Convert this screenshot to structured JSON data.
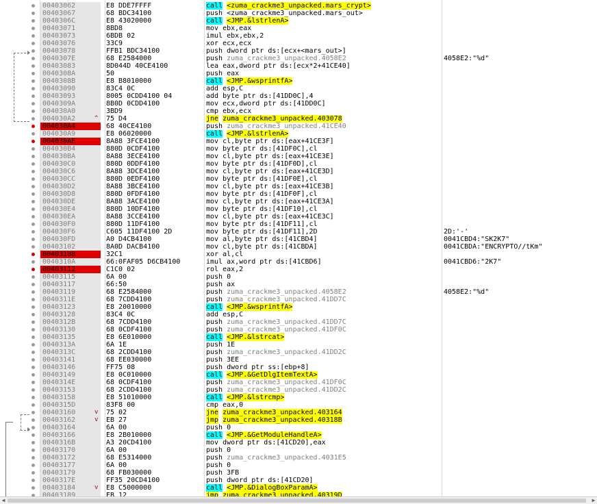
{
  "rows": [
    {
      "addr": "00403062",
      "bytes": "E8 DDE7FFFF",
      "kind": "call",
      "op": "call",
      "arg": "<zuma_crackme3_unpacked.mars_crypt>",
      "comment": ""
    },
    {
      "addr": "00403067",
      "bytes": "68 BDC34100",
      "kind": "plain",
      "op": "push",
      "arg": "<zuma_crackme3_unpacked.mars_out>",
      "comment": ""
    },
    {
      "addr": "0040306C",
      "bytes": "E8 43020000",
      "kind": "call",
      "op": "call",
      "arg": "<JMP.&lstrlenA>",
      "comment": ""
    },
    {
      "addr": "00403071",
      "bytes": "8BD8",
      "kind": "plain",
      "op": "mov",
      "arg": "ebx,eax",
      "comment": ""
    },
    {
      "addr": "00403073",
      "bytes": "6BDB 02",
      "kind": "plain",
      "op": "imul",
      "arg": "ebx,ebx,2",
      "comment": ""
    },
    {
      "addr": "00403076",
      "bytes": "33C9",
      "kind": "plain",
      "op": "xor",
      "arg": "ecx,ecx",
      "comment": ""
    },
    {
      "addr": "00403078",
      "bytes": "FFB1 BDC34100",
      "kind": "plain",
      "op": "push",
      "arg": "dword ptr ds:[ecx+<mars_out>]",
      "comment": ""
    },
    {
      "addr": "0040307E",
      "bytes": "68 E2584000",
      "kind": "plain",
      "op": "push",
      "arg": "zuma_crackme3_unpacked.4058E2",
      "comment": "4058E2:\"%d\""
    },
    {
      "addr": "00403083",
      "bytes": "8D044D 40CE4100",
      "kind": "plain",
      "op": "lea",
      "arg": "eax,dword ptr ds:[ecx*2+41CE40]",
      "comment": ""
    },
    {
      "addr": "0040308A",
      "bytes": "50",
      "kind": "plain",
      "op": "push",
      "arg": "eax",
      "comment": ""
    },
    {
      "addr": "0040308B",
      "bytes": "E8 B8010000",
      "kind": "call",
      "op": "call",
      "arg": "<JMP.&wsprintfA>",
      "comment": ""
    },
    {
      "addr": "00403090",
      "bytes": "83C4 0C",
      "kind": "plain",
      "op": "add",
      "arg": "esp,C",
      "comment": ""
    },
    {
      "addr": "00403093",
      "bytes": "8005 0CDD4100 04",
      "kind": "plain",
      "op": "add",
      "arg": "byte ptr ds:[41DD0C],4",
      "comment": ""
    },
    {
      "addr": "0040309A",
      "bytes": "8B0D 0CDD4100",
      "kind": "plain",
      "op": "mov",
      "arg": "ecx,dword ptr ds:[41DD0C]",
      "comment": ""
    },
    {
      "addr": "004030A0",
      "bytes": "3BD9",
      "kind": "plain",
      "op": "cmp",
      "arg": "ebx,ecx",
      "comment": ""
    },
    {
      "addr": "004030A2",
      "bytes": "75 D4",
      "kind": "jmp",
      "op": "jne",
      "arg": "zuma_crackme3_unpacked.403078",
      "comment": ""
    },
    {
      "addr": "004030A4",
      "bytes": "68 40CE4100",
      "kind": "plain",
      "op": "push",
      "arg": "zuma_crackme3_unpacked.41CE40",
      "comment": ""
    },
    {
      "addr": "004030A9",
      "bytes": "E8 06020000",
      "kind": "call",
      "op": "call",
      "arg": "<JMP.&lstrlenA>",
      "comment": ""
    },
    {
      "addr": "004030AE",
      "bytes": "8A88 3FCE4100",
      "kind": "plain",
      "op": "mov",
      "arg": "cl,byte ptr ds:[eax+41CE3F]",
      "comment": ""
    },
    {
      "addr": "004030B4",
      "bytes": "880D 0CDF4100",
      "kind": "plain",
      "op": "mov",
      "arg": "byte ptr ds:[41DF0C],cl",
      "comment": ""
    },
    {
      "addr": "004030BA",
      "bytes": "8A88 3ECE4100",
      "kind": "plain",
      "op": "mov",
      "arg": "cl,byte ptr ds:[eax+41CE3E]",
      "comment": ""
    },
    {
      "addr": "004030C0",
      "bytes": "880D 0DDF4100",
      "kind": "plain",
      "op": "mov",
      "arg": "byte ptr ds:[41DF0D],cl",
      "comment": ""
    },
    {
      "addr": "004030C6",
      "bytes": "8A88 3DCE4100",
      "kind": "plain",
      "op": "mov",
      "arg": "cl,byte ptr ds:[eax+41CE3D]",
      "comment": ""
    },
    {
      "addr": "004030CC",
      "bytes": "880D 0EDF4100",
      "kind": "plain",
      "op": "mov",
      "arg": "byte ptr ds:[41DF0E],cl",
      "comment": ""
    },
    {
      "addr": "004030D2",
      "bytes": "8A88 3BCE4100",
      "kind": "plain",
      "op": "mov",
      "arg": "cl,byte ptr ds:[eax+41CE3B]",
      "comment": ""
    },
    {
      "addr": "004030D8",
      "bytes": "880D 0FDF4100",
      "kind": "plain",
      "op": "mov",
      "arg": "byte ptr ds:[41DF0F],cl",
      "comment": ""
    },
    {
      "addr": "004030DE",
      "bytes": "8A88 3ACE4100",
      "kind": "plain",
      "op": "mov",
      "arg": "cl,byte ptr ds:[eax+41CE3A]",
      "comment": ""
    },
    {
      "addr": "004030E4",
      "bytes": "880D 10DF4100",
      "kind": "plain",
      "op": "mov",
      "arg": "byte ptr ds:[41DF10],cl",
      "comment": ""
    },
    {
      "addr": "004030EA",
      "bytes": "8A88 3CCE4100",
      "kind": "plain",
      "op": "mov",
      "arg": "cl,byte ptr ds:[eax+41CE3C]",
      "comment": ""
    },
    {
      "addr": "004030F0",
      "bytes": "880D 11DF4100",
      "kind": "plain",
      "op": "mov",
      "arg": "byte ptr ds:[41DF11],cl",
      "comment": ""
    },
    {
      "addr": "004030F6",
      "bytes": "C605 11DF4100 2D",
      "kind": "plain",
      "op": "mov",
      "arg": "byte ptr ds:[41DF11],2D",
      "comment": "2D:'-'"
    },
    {
      "addr": "004030FD",
      "bytes": "A0 D4CB4100",
      "kind": "plain",
      "op": "mov",
      "arg": "al,byte ptr ds:[41CBD4]",
      "comment": "0041CBD4:\"SK2K7\""
    },
    {
      "addr": "00403102",
      "bytes": "8A0D DACB4100",
      "kind": "plain",
      "op": "mov",
      "arg": "cl,byte ptr ds:[41CBDA]",
      "comment": "0041CBDA:\"ENCRYPTO//tKm\""
    },
    {
      "addr": "00403108",
      "bytes": "32C1",
      "kind": "plain",
      "op": "xor",
      "arg": "al,cl",
      "comment": ""
    },
    {
      "addr": "0040310A",
      "bytes": "66:0FAF05 D6CB4100",
      "kind": "plain",
      "op": "imul",
      "arg": "ax,word ptr ds:[41CBD6]",
      "comment": "0041CBD6:\"2K7\""
    },
    {
      "addr": "00403112",
      "bytes": "C1C0 02",
      "kind": "plain",
      "op": "rol",
      "arg": "eax,2",
      "comment": ""
    },
    {
      "addr": "00403115",
      "bytes": "6A 00",
      "kind": "plain",
      "op": "push",
      "arg": "0",
      "comment": ""
    },
    {
      "addr": "00403117",
      "bytes": "66:50",
      "kind": "plain",
      "op": "push",
      "arg": "ax",
      "comment": ""
    },
    {
      "addr": "00403119",
      "bytes": "68 E2584000",
      "kind": "plain",
      "op": "push",
      "arg": "zuma_crackme3_unpacked.4058E2",
      "comment": "4058E2:\"%d\""
    },
    {
      "addr": "0040311E",
      "bytes": "68 7CDD4100",
      "kind": "plain",
      "op": "push",
      "arg": "zuma_crackme3_unpacked.41DD7C",
      "comment": ""
    },
    {
      "addr": "00403123",
      "bytes": "E8 20010000",
      "kind": "call",
      "op": "call",
      "arg": "<JMP.&wsprintfA>",
      "comment": ""
    },
    {
      "addr": "00403128",
      "bytes": "83C4 0C",
      "kind": "plain",
      "op": "add",
      "arg": "esp,C",
      "comment": ""
    },
    {
      "addr": "0040312B",
      "bytes": "68 7CDD4100",
      "kind": "plain",
      "op": "push",
      "arg": "zuma_crackme3_unpacked.41DD7C",
      "comment": ""
    },
    {
      "addr": "00403130",
      "bytes": "68 0CDF4100",
      "kind": "plain",
      "op": "push",
      "arg": "zuma_crackme3_unpacked.41DF0C",
      "comment": ""
    },
    {
      "addr": "00403135",
      "bytes": "E8 6E010000",
      "kind": "call",
      "op": "call",
      "arg": "<JMP.&lstrcat>",
      "comment": ""
    },
    {
      "addr": "0040313A",
      "bytes": "6A 1E",
      "kind": "plain",
      "op": "push",
      "arg": "1E",
      "comment": ""
    },
    {
      "addr": "0040313C",
      "bytes": "68 2CDD4100",
      "kind": "plain",
      "op": "push",
      "arg": "zuma_crackme3_unpacked.41DD2C",
      "comment": ""
    },
    {
      "addr": "00403141",
      "bytes": "68 EE030000",
      "kind": "plain",
      "op": "push",
      "arg": "3EE",
      "comment": ""
    },
    {
      "addr": "00403146",
      "bytes": "FF75 08",
      "kind": "plain",
      "op": "push",
      "arg": "dword ptr ss:[ebp+8]",
      "comment": ""
    },
    {
      "addr": "00403149",
      "bytes": "E8 0C010000",
      "kind": "call",
      "op": "call",
      "arg": "<JMP.&GetDlgItemTextA>",
      "comment": ""
    },
    {
      "addr": "0040314E",
      "bytes": "68 0CDF4100",
      "kind": "plain",
      "op": "push",
      "arg": "zuma_crackme3_unpacked.41DF0C",
      "comment": ""
    },
    {
      "addr": "00403153",
      "bytes": "68 2CDD4100",
      "kind": "plain",
      "op": "push",
      "arg": "zuma_crackme3_unpacked.41DD2C",
      "comment": ""
    },
    {
      "addr": "00403158",
      "bytes": "E8 51010000",
      "kind": "call",
      "op": "call",
      "arg": "<JMP.&lstrcmp>",
      "comment": ""
    },
    {
      "addr": "0040315D",
      "bytes": "83F8 00",
      "kind": "plain",
      "op": "cmp",
      "arg": "eax,0",
      "comment": ""
    },
    {
      "addr": "00403160",
      "bytes": "75 02",
      "kind": "jmp",
      "op": "jne",
      "arg": "zuma_crackme3_unpacked.403164",
      "comment": ""
    },
    {
      "addr": "00403162",
      "bytes": "EB 27",
      "kind": "jmp",
      "op": "jmp",
      "arg": "zuma_crackme3_unpacked.40318B",
      "comment": ""
    },
    {
      "addr": "00403164",
      "bytes": "6A 00",
      "kind": "plain",
      "op": "push",
      "arg": "0",
      "comment": ""
    },
    {
      "addr": "00403166",
      "bytes": "E8 2B010000",
      "kind": "call",
      "op": "call",
      "arg": "<JMP.&GetModuleHandleA>",
      "comment": ""
    },
    {
      "addr": "0040316B",
      "bytes": "A3 20CD4100",
      "kind": "plain",
      "op": "mov",
      "arg": "dword ptr ds:[41CD20],eax",
      "comment": ""
    },
    {
      "addr": "00403170",
      "bytes": "6A 00",
      "kind": "plain",
      "op": "push",
      "arg": "0",
      "comment": ""
    },
    {
      "addr": "00403172",
      "bytes": "68 E5314000",
      "kind": "plain",
      "op": "push",
      "arg": "zuma_crackme3_unpacked.4031E5",
      "comment": ""
    },
    {
      "addr": "00403177",
      "bytes": "6A 00",
      "kind": "plain",
      "op": "push",
      "arg": "0",
      "comment": ""
    },
    {
      "addr": "00403179",
      "bytes": "68 FB030000",
      "kind": "plain",
      "op": "push",
      "arg": "3FB",
      "comment": ""
    },
    {
      "addr": "0040317E",
      "bytes": "FF35 20CD4100",
      "kind": "plain",
      "op": "push",
      "arg": "dword ptr ds:[41CD20]",
      "comment": ""
    },
    {
      "addr": "00403184",
      "bytes": "E8 C5000000",
      "kind": "call",
      "op": "call",
      "arg": "<JMP.&DialogBoxParamA>",
      "comment": ""
    },
    {
      "addr": "00403189",
      "bytes": "EB 12",
      "kind": "jmp",
      "op": "jmp",
      "arg": "zuma_crackme3_unpacked.40319D",
      "comment": ""
    }
  ],
  "breakpoint_rows": [
    16,
    18,
    33,
    35
  ],
  "jump_marks": {
    "15": "^",
    "54": "v",
    "55": "v",
    "64": "v"
  },
  "colors": {
    "call_bg": "#00ffff",
    "jump_bg": "#ffff00",
    "breakpoint": "#e00000"
  },
  "icons": {
    "scroll_left": "scroll-left-icon",
    "scroll_right": "scroll-right-icon"
  }
}
